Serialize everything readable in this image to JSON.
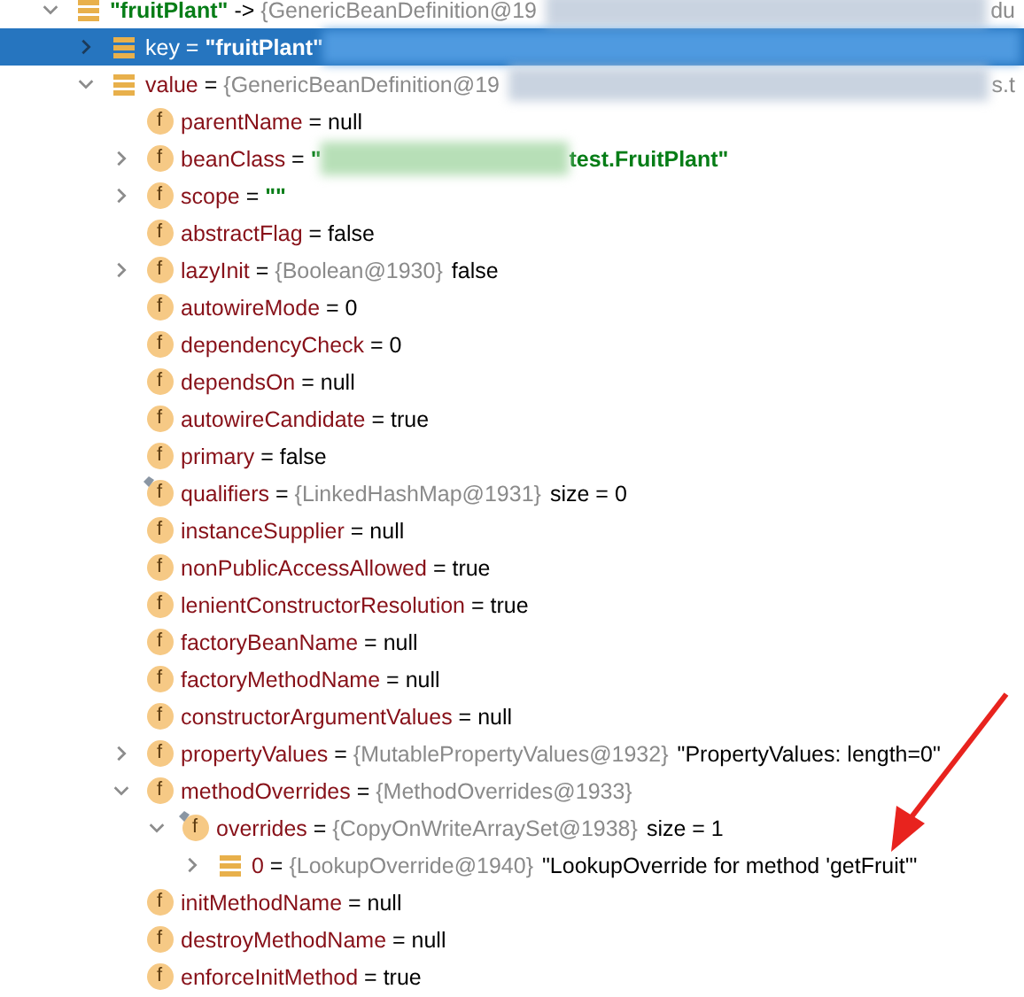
{
  "tree": [
    {
      "kind": "entry",
      "name": "\"fruitPlant\"",
      "string_name": true,
      "op": " -> ",
      "type": "{GenericBeanDefinition@19",
      "redacted": true,
      "tail": "du",
      "expandable": true,
      "expanded": true,
      "selected": false,
      "children": [
        {
          "kind": "entry",
          "name": "key",
          "op": " = ",
          "value": "\"fruitPlant\"",
          "string_value": true,
          "redacted": true,
          "expandable": true,
          "expanded": false,
          "selected": true
        },
        {
          "kind": "entry",
          "name": "value",
          "op": " = ",
          "type": "{GenericBeanDefinition@19",
          "redacted": true,
          "tail": "s.t",
          "expandable": true,
          "expanded": true,
          "selected": false,
          "children": [
            {
              "kind": "field",
              "badge": "f",
              "name": "parentName",
              "op": " = ",
              "value": "null",
              "expandable": false,
              "selected": false
            },
            {
              "kind": "field",
              "badge": "f",
              "name": "beanClass",
              "op": " = ",
              "value": "\"",
              "string_value": true,
              "redacted": true,
              "tail": "test.FruitPlant\"",
              "expandable": true,
              "expanded": false,
              "selected": false
            },
            {
              "kind": "field",
              "badge": "f",
              "name": "scope",
              "op": " = ",
              "value": "\"\"",
              "string_value": true,
              "expandable": true,
              "expanded": false,
              "selected": false
            },
            {
              "kind": "field",
              "badge": "f",
              "name": "abstractFlag",
              "op": " = ",
              "value": "false",
              "expandable": false,
              "selected": false
            },
            {
              "kind": "field",
              "badge": "f",
              "name": "lazyInit",
              "op": " = ",
              "type": "{Boolean@1930}",
              "value": "false",
              "expandable": true,
              "expanded": false,
              "selected": false
            },
            {
              "kind": "field",
              "badge": "f",
              "name": "autowireMode",
              "op": " = ",
              "value": "0",
              "expandable": false,
              "selected": false
            },
            {
              "kind": "field",
              "badge": "f",
              "name": "dependencyCheck",
              "op": " = ",
              "value": "0",
              "expandable": false,
              "selected": false
            },
            {
              "kind": "field",
              "badge": "f",
              "name": "dependsOn",
              "op": " = ",
              "value": "null",
              "expandable": false,
              "selected": false
            },
            {
              "kind": "field",
              "badge": "f",
              "name": "autowireCandidate",
              "op": " = ",
              "value": "true",
              "expandable": false,
              "selected": false
            },
            {
              "kind": "field",
              "badge": "f",
              "name": "primary",
              "op": " = ",
              "value": "false",
              "expandable": false,
              "selected": false
            },
            {
              "kind": "field",
              "badge": "f",
              "name": "qualifiers",
              "op": " = ",
              "type": "{LinkedHashMap@1931}",
              "value": "size = 0",
              "annotated": true,
              "expandable": false,
              "selected": false
            },
            {
              "kind": "field",
              "badge": "f",
              "name": "instanceSupplier",
              "op": " = ",
              "value": "null",
              "expandable": false,
              "selected": false
            },
            {
              "kind": "field",
              "badge": "f",
              "name": "nonPublicAccessAllowed",
              "op": " = ",
              "value": "true",
              "expandable": false,
              "selected": false
            },
            {
              "kind": "field",
              "badge": "f",
              "name": "lenientConstructorResolution",
              "op": " = ",
              "value": "true",
              "expandable": false,
              "selected": false
            },
            {
              "kind": "field",
              "badge": "f",
              "name": "factoryBeanName",
              "op": " = ",
              "value": "null",
              "expandable": false,
              "selected": false
            },
            {
              "kind": "field",
              "badge": "f",
              "name": "factoryMethodName",
              "op": " = ",
              "value": "null",
              "expandable": false,
              "selected": false
            },
            {
              "kind": "field",
              "badge": "f",
              "name": "constructorArgumentValues",
              "op": " = ",
              "value": "null",
              "expandable": false,
              "selected": false
            },
            {
              "kind": "field",
              "badge": "f",
              "name": "propertyValues",
              "op": " = ",
              "type": "{MutablePropertyValues@1932}",
              "value": "\"PropertyValues: length=0\"",
              "expandable": true,
              "expanded": false,
              "selected": false
            },
            {
              "kind": "field",
              "badge": "f",
              "name": "methodOverrides",
              "op": " = ",
              "type": "{MethodOverrides@1933}",
              "expandable": true,
              "expanded": true,
              "selected": false,
              "children": [
                {
                  "kind": "field",
                  "badge": "f",
                  "name": "overrides",
                  "op": " = ",
                  "type": "{CopyOnWriteArraySet@1938}",
                  "value": "size = 1",
                  "annotated": true,
                  "expandable": true,
                  "expanded": true,
                  "selected": false,
                  "children": [
                    {
                      "kind": "entry",
                      "name": "0",
                      "op": " = ",
                      "type": "{LookupOverride@1940}",
                      "value": "\"LookupOverride for method 'getFruit'\"",
                      "expandable": true,
                      "expanded": false,
                      "selected": false
                    }
                  ]
                }
              ]
            },
            {
              "kind": "field",
              "badge": "f",
              "name": "initMethodName",
              "op": " = ",
              "value": "null",
              "expandable": false,
              "selected": false
            },
            {
              "kind": "field",
              "badge": "f",
              "name": "destroyMethodName",
              "op": " = ",
              "value": "null",
              "expandable": false,
              "selected": false
            },
            {
              "kind": "field",
              "badge": "f",
              "name": "enforceInitMethod",
              "op": " = ",
              "value": "true",
              "expandable": false,
              "selected": false
            }
          ]
        }
      ]
    }
  ]
}
